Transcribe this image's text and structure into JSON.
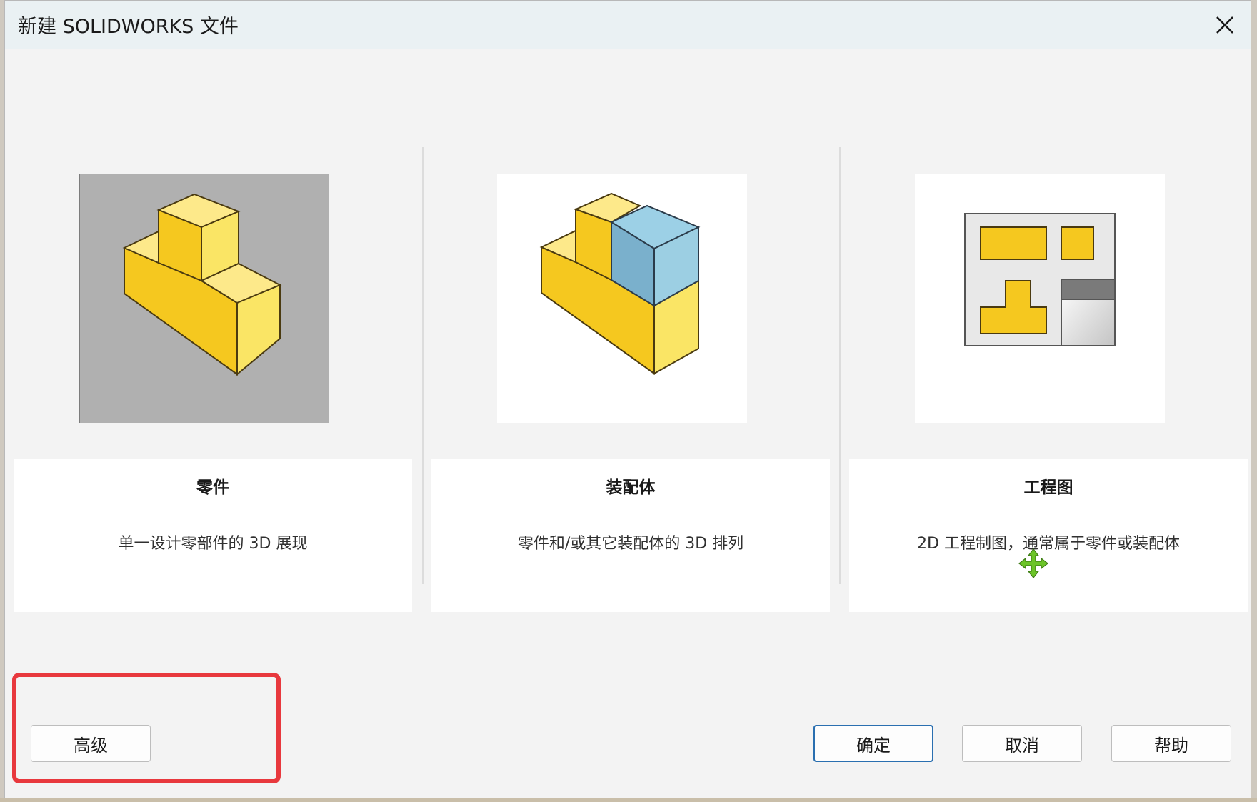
{
  "window": {
    "title": "新建 SOLIDWORKS 文件"
  },
  "templates": [
    {
      "label": "零件",
      "description": "单一设计零部件的 3D 展现",
      "icon": "part-icon",
      "selected": true
    },
    {
      "label": "装配体",
      "description": "零件和/或其它装配体的 3D 排列",
      "icon": "assembly-icon",
      "selected": false
    },
    {
      "label": "工程图",
      "description": "2D 工程制图，通常属于零件或装配体",
      "icon": "drawing-icon",
      "selected": false
    }
  ],
  "buttons": {
    "advanced": "高级",
    "ok": "确定",
    "cancel": "取消",
    "help": "帮助"
  },
  "colors": {
    "selection_bg": "#b0b0b0",
    "part_yellow": "#f5c81f",
    "assembly_blue": "#8fc3dc",
    "highlight_red": "#e8383d",
    "primary_border": "#2a6fb0"
  }
}
